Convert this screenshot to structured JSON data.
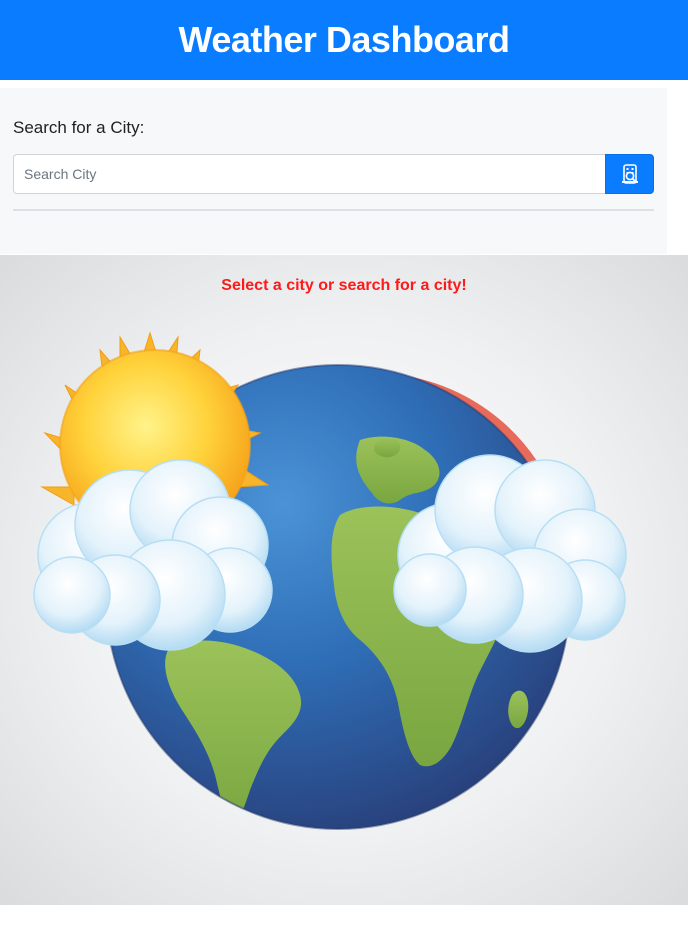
{
  "header": {
    "title": "Weather Dashboard"
  },
  "search": {
    "label": "Search for a City:",
    "placeholder": "Search City",
    "value": "",
    "button_icon": "search-city-icon"
  },
  "hero": {
    "prompt": "Select a city or search for a city!",
    "illustration": "earth-with-sun-rainbow-clouds"
  },
  "colors": {
    "accent": "#0a7cff",
    "prompt": "#ff1a1a"
  }
}
